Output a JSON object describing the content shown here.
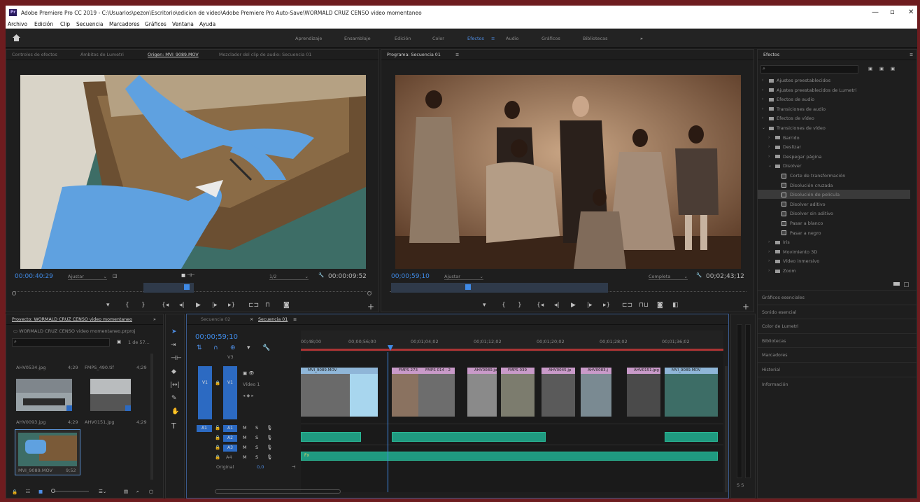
{
  "title_bar": {
    "app_icon": "Pr",
    "title": "Adobe Premiere Pro CC 2019 - C:\\Usuarios\\pezon\\Escritorio\\edicion de video\\Adobe Premiere Pro Auto-Save\\WORMALD CRUZ CENSO video momentaneo",
    "minimize": "—",
    "maximize": "▫",
    "close": "✕"
  },
  "menu": [
    "Archivo",
    "Edición",
    "Clip",
    "Secuencia",
    "Marcadores",
    "Gráficos",
    "Ventana",
    "Ayuda"
  ],
  "workspaces": {
    "items": [
      "Aprendizaje",
      "Ensamblaje",
      "Edición",
      "Color",
      "Efectos",
      "Audio",
      "Gráficos",
      "Bibliotecas"
    ],
    "active": "Efectos",
    "more": "»"
  },
  "source_panel": {
    "tabs": [
      "Controles de efectos",
      "Ámbitos de Lumetri",
      "Origen: MVI_9089.MOV",
      "Mezclador del clip de audio: Secuencia 01"
    ],
    "active_tab": "Origen: MVI_9089.MOV",
    "timecode": "00:00:40:29",
    "fit": "Ajustar",
    "resolution": "1/2",
    "duration": "00:00:09:52"
  },
  "program_panel": {
    "tab": "Programa: Secuencia 01",
    "timecode": "00;00;59;10",
    "fit": "Ajustar",
    "quality": "Completa",
    "duration": "00;02;43;12"
  },
  "effects_panel": {
    "title": "Efectos",
    "tree": [
      {
        "label": "Ajustes preestablecidos",
        "level": 0,
        "type": "folder"
      },
      {
        "label": "Ajustes preestablecidos de Lumetri",
        "level": 0,
        "type": "folder"
      },
      {
        "label": "Efectos de audio",
        "level": 0,
        "type": "folder"
      },
      {
        "label": "Transiciones de audio",
        "level": 0,
        "type": "folder"
      },
      {
        "label": "Efectos de vídeo",
        "level": 0,
        "type": "folder"
      },
      {
        "label": "Transiciones de vídeo",
        "level": 0,
        "type": "folder"
      },
      {
        "label": "Barrido",
        "level": 1,
        "type": "folder"
      },
      {
        "label": "Deslizar",
        "level": 1,
        "type": "folder"
      },
      {
        "label": "Despegar página",
        "level": 1,
        "type": "folder"
      },
      {
        "label": "Disolver",
        "level": 1,
        "type": "folder"
      },
      {
        "label": "Corte de transformación",
        "level": 2,
        "type": "fx"
      },
      {
        "label": "Disolución cruzada",
        "level": 2,
        "type": "fx"
      },
      {
        "label": "Disolución de película",
        "level": 2,
        "type": "fx",
        "selected": true
      },
      {
        "label": "Disolver aditivo",
        "level": 2,
        "type": "fx"
      },
      {
        "label": "Disolver sin aditivo",
        "level": 2,
        "type": "fx"
      },
      {
        "label": "Pasar a blanco",
        "level": 2,
        "type": "fx"
      },
      {
        "label": "Pasar a negro",
        "level": 2,
        "type": "fx"
      },
      {
        "label": "Iris",
        "level": 1,
        "type": "folder"
      },
      {
        "label": "Movimiento 3D",
        "level": 1,
        "type": "folder"
      },
      {
        "label": "Vídeo inmersivo",
        "level": 1,
        "type": "folder"
      },
      {
        "label": "Zoom",
        "level": 1,
        "type": "folder"
      }
    ],
    "sub_panels": [
      "Gráficos esenciales",
      "Sonido esencial",
      "Color de Lumetri",
      "Bibliotecas",
      "Marcadores",
      "Historial",
      "Información"
    ]
  },
  "project_panel": {
    "tab": "Proyecto: WORMALD CRUZ CENSO video momentaneo",
    "more": "»",
    "file": "WORMALD CRUZ CENSO video momentaneo.prproj",
    "count": "1 de 57...",
    "items": [
      {
        "name": "AHV0534.jpg",
        "dur": "4;29"
      },
      {
        "name": "FMPS_490.tif",
        "dur": "4;29"
      },
      {
        "name": "AHV0093.jpg",
        "dur": "4;29"
      },
      {
        "name": "AHV0151.jpg",
        "dur": "4;29"
      },
      {
        "name": "MVI_9089.MOV",
        "dur": "9;52"
      }
    ]
  },
  "timeline": {
    "tabs": [
      "Secuencia 02",
      "Secuencia 01"
    ],
    "active_tab": "Secuencia 01",
    "timecode": "00;00;59;10",
    "ruler": [
      "00;48;00",
      "00;00;56;00",
      "00;01;04;02",
      "00;01;12;02",
      "00;01;20;02",
      "00;01;28;02",
      "00;01;36;02"
    ],
    "tracks": {
      "v3": "V3",
      "v1_left": "V1",
      "v1": "V1",
      "video1": "Vídeo 1",
      "a1_left": "A1",
      "a1": "A1",
      "a2": "A2",
      "a3": "A3",
      "a4": "A4",
      "original": "Original",
      "original_val": "0,0",
      "m": "M",
      "s": "S"
    },
    "clips": [
      "MVI_9089.MOV",
      "FMPS 273",
      "FMPS 014 - 2",
      "AHV0080.jp",
      "FMPS 039",
      "AHV0045.jp",
      "AHV0083.j",
      "AHV0151.jpg",
      "MVI_9089.MOV"
    ],
    "audio_label": "Fx"
  },
  "meter": {
    "db": "S S"
  }
}
